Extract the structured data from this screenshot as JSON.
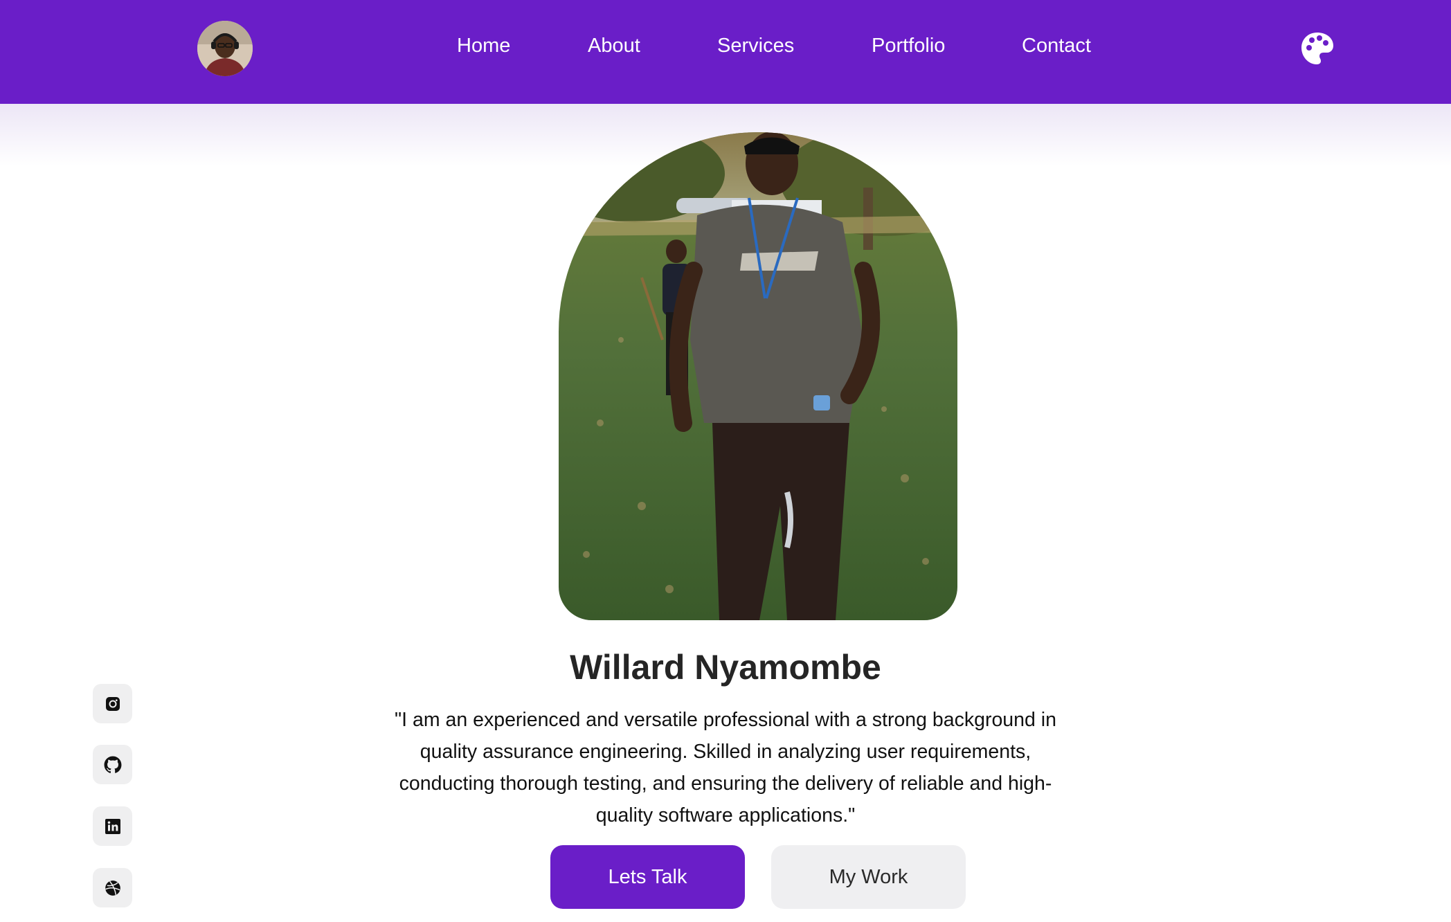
{
  "nav": {
    "links": [
      "Home",
      "About",
      "Services",
      "Portfolio",
      "Contact"
    ]
  },
  "hero": {
    "name": "Willard Nyamombe",
    "description": "\"I am an experienced and versatile professional with a strong background in quality assurance engineering. Skilled in analyzing user requirements, conducting thorough testing, and ensuring the delivery of reliable and high-quality software applications.\"",
    "primary_button": "Lets Talk",
    "secondary_button": "My Work"
  },
  "social": {
    "icons": [
      "instagram-icon",
      "github-icon",
      "linkedin-icon",
      "dribbble-icon"
    ]
  },
  "colors": {
    "accent": "#6a1ec8",
    "nav_text": "#ffffff",
    "secondary_button_bg": "#efeff1",
    "social_bg": "#efeff0"
  }
}
